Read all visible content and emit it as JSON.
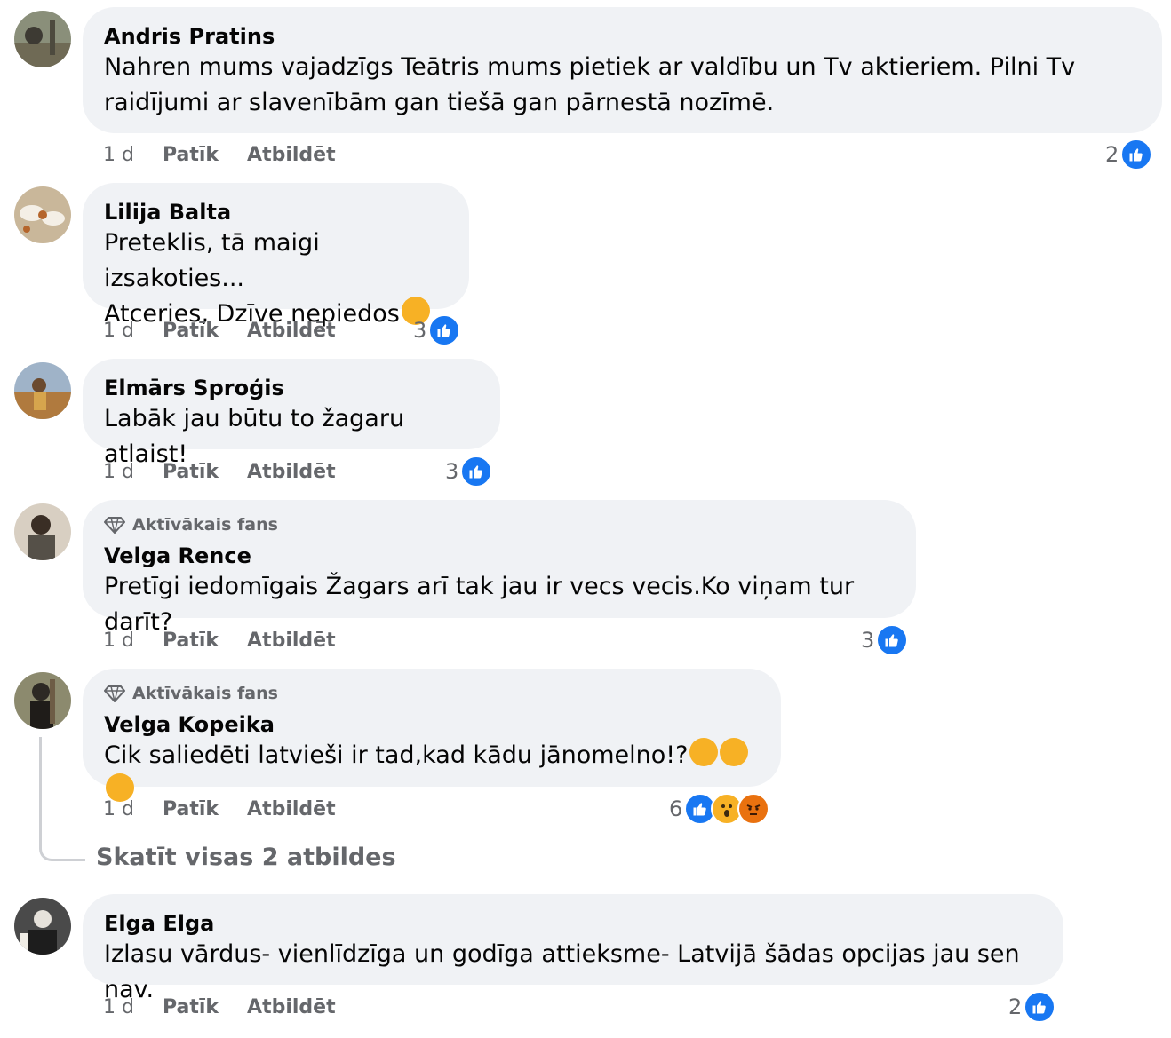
{
  "actions": {
    "time": "1 d",
    "like": "Patīk",
    "reply": "Atbildēt"
  },
  "badge_label": "Aktīvākais fans",
  "comments": [
    {
      "author": "Andris Pratins",
      "lines": [
        "Nahren mums vajadzīgs Teātris mums pietiek ar valdību un Tv aktieriem. Pilni Tv",
        "raidījumi ar slavenībām gan tiešā gan pārnestā nozīmē."
      ],
      "reactions": {
        "count": "2",
        "icons": [
          "like-icon"
        ]
      }
    },
    {
      "author": "Lilija Balta",
      "lines": [
        "Preteklis, tā maigi izsakoties...",
        "Atceries, Dzīve nepiedos"
      ],
      "emoji_after_text": [
        "rolling-laughing-emoji"
      ],
      "reactions": {
        "count": "3",
        "icons": [
          "like-icon"
        ]
      }
    },
    {
      "author": "Elmārs Sproģis",
      "lines": [
        "Labāk jau būtu to žagaru atlaist!"
      ],
      "reactions": {
        "count": "3",
        "icons": [
          "like-icon"
        ]
      }
    },
    {
      "author": "Velga Rence",
      "top_fan": true,
      "lines": [
        "Pretīgi iedomīgais Žagars arī tak jau ir vecs vecis.Ko viņam tur darīt?"
      ],
      "reactions": {
        "count": "3",
        "icons": [
          "like-icon"
        ]
      }
    },
    {
      "author": "Velga Kopeika",
      "top_fan": true,
      "lines": [
        "Cik saliedēti latvieši ir tad,kad kādu jānomelno!?"
      ],
      "emoji_after_text": [
        "flushed-emoji",
        "thinking-emoji",
        "worried-emoji"
      ],
      "reactions": {
        "count": "6",
        "icons": [
          "like-icon",
          "wow-icon",
          "angry-icon"
        ]
      }
    },
    {
      "author": "Elga Elga",
      "lines": [
        "Izlasu vārdus- vienlīdzīga un godīga attieksme- Latvijā šādas opcijas jau sen nav."
      ],
      "reactions": {
        "count": "2",
        "icons": [
          "like-icon"
        ]
      }
    }
  ],
  "view_replies": "Skatīt visas 2 atbildes",
  "colors": {
    "bubble": "#f0f2f5",
    "secondary_text": "#65676b",
    "like_blue": "#1877f2",
    "wow_yellow": "#f7b125",
    "angry_orange": "#e9710f"
  }
}
